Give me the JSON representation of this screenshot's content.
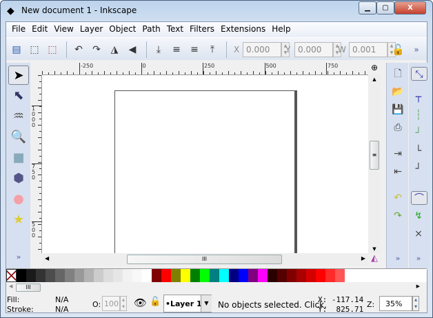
{
  "window": {
    "title": "New document 1 - Inkscape",
    "minimize": "▁",
    "maximize": "▢",
    "close": "X"
  },
  "menu": [
    "File",
    "Edit",
    "View",
    "Layer",
    "Object",
    "Path",
    "Text",
    "Filters",
    "Extensions",
    "Help"
  ],
  "toolbar": {
    "x_label": "X",
    "x_value": "0.000",
    "y_label": "Y",
    "y_value": "0.000",
    "w_label": "W",
    "w_value": "0.001",
    "more": "»"
  },
  "rulers": {
    "top": [
      "-250",
      "0",
      "250",
      "500",
      "750",
      "100"
    ],
    "left": [
      "1\n0\n0\n0",
      "7\n5\n0",
      "5\n0\n0"
    ]
  },
  "toolbox_more": "»",
  "palette": [
    "#000000",
    "#1a1a1a",
    "#333333",
    "#4d4d4d",
    "#666666",
    "#808080",
    "#999999",
    "#b3b3b3",
    "#cccccc",
    "#dddddd",
    "#e6e6e6",
    "#f2f2f2",
    "#f8f8f8",
    "#ffffff",
    "#800000",
    "#ff0000",
    "#808000",
    "#ffff00",
    "#008000",
    "#00ff00",
    "#008080",
    "#00ffff",
    "#000080",
    "#0000ff",
    "#800080",
    "#ff00ff",
    "#2b0000",
    "#550000",
    "#800000",
    "#aa0000",
    "#d40000",
    "#ff0000",
    "#ff2a2a",
    "#ff5555"
  ],
  "status": {
    "fill_label": "Fill:",
    "fill_value": "N/A",
    "stroke_label": "Stroke:",
    "stroke_value": "N/A",
    "opacity_label": "O:",
    "opacity_value": "100",
    "layer": "•Layer 1",
    "message": "No objects selected. Click,",
    "x_coord": "X: -117.14",
    "y_coord": "Y:  825.71",
    "zoom_label": "Z:",
    "zoom_value": "35%"
  }
}
